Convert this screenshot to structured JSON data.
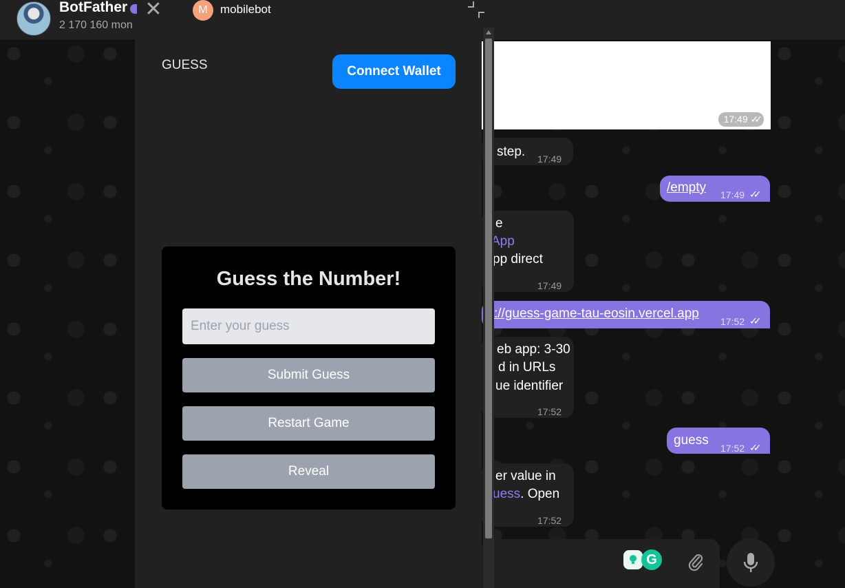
{
  "header": {
    "peer_name": "BotFather",
    "peer_status": "2 170 160 mon"
  },
  "popup": {
    "tab_avatar_letter": "M",
    "tab_title": "mobilebot",
    "close_glyph": "✕",
    "app_brand": "GUESS",
    "connect_wallet_label": "Connect Wallet",
    "accent_color": "#0b84ff"
  },
  "game": {
    "title": "Guess the Number!",
    "input_placeholder": "Enter your guess",
    "input_value": "",
    "submit_label": "Submit Guess",
    "restart_label": "Restart Game",
    "reveal_label": "Reveal"
  },
  "messages": [
    {
      "id": "media",
      "time": "17:49"
    },
    {
      "id": "m1",
      "text": "step.",
      "time": "17:49"
    },
    {
      "id": "m2",
      "text": "/empty",
      "time": "17:49",
      "outgoing": true
    },
    {
      "id": "m3",
      "lines": [
        "e",
        "App",
        "pp direct"
      ],
      "time": "17:49"
    },
    {
      "id": "m4",
      "text": "://guess-game-tau-eosin.vercel.app",
      "time": "17:52",
      "outgoing": true
    },
    {
      "id": "m5",
      "lines": [
        "eb app: 3-30",
        "d in URLs",
        "ue identifier"
      ],
      "time": "17:52"
    },
    {
      "id": "m6",
      "text": "guess",
      "time": "17:52",
      "outgoing": true
    },
    {
      "id": "m7",
      "lines": [
        "er value in",
        "uess",
        ". Open"
      ],
      "time": "17:52"
    }
  ],
  "composer": {
    "ext_badge_2": "G"
  }
}
